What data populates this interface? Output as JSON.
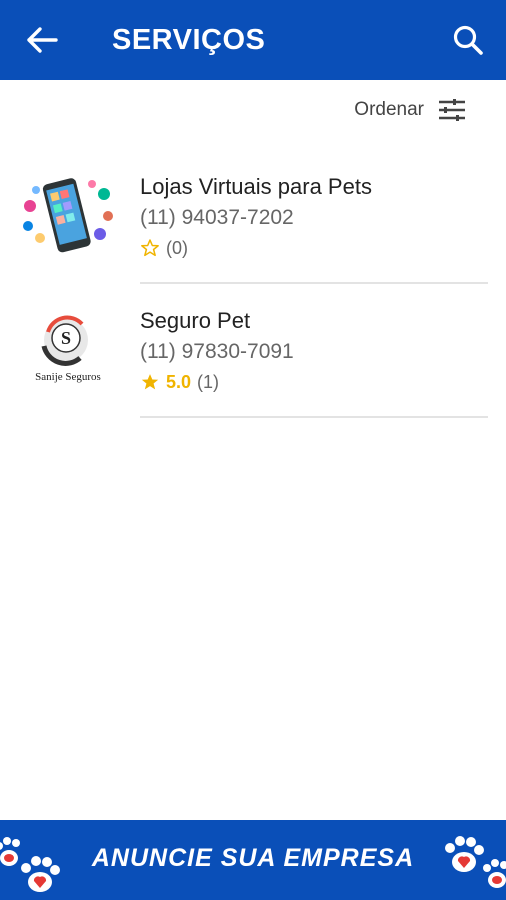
{
  "header": {
    "title": "SERVIÇOS",
    "back_icon": "arrow-left-icon",
    "search_icon": "search-icon",
    "background": "#0a4fb8"
  },
  "sort": {
    "label": "Ordenar",
    "icon": "sliders-icon"
  },
  "listings": [
    {
      "name": "Lojas Virtuais para Pets",
      "phone": "(11) 94037-7202",
      "rating_score": "",
      "rating_count": "(0)",
      "star": "empty-star-icon"
    },
    {
      "name": "Seguro Pet",
      "phone": "(11) 97830-7091",
      "rating_score": "5.0",
      "rating_count": "(1)",
      "star": "filled-star-icon",
      "logo_text": "Sanije Seguros"
    }
  ],
  "banner": {
    "text": "ANUNCIE SUA EMPRESA",
    "icon": "paw-icon"
  },
  "colors": {
    "brand": "#0a4fb8",
    "star": "#f0b400",
    "paw": "#e53935"
  }
}
